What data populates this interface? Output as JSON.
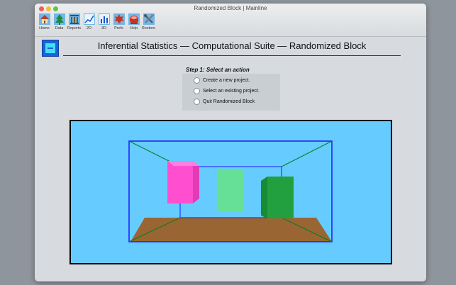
{
  "window": {
    "title": "Randomized Block | Mainline"
  },
  "toolbar": [
    {
      "label": "Home",
      "icon": "home-icon"
    },
    {
      "label": "Data",
      "icon": "tree-icon"
    },
    {
      "label": "Reports",
      "icon": "columns-icon"
    },
    {
      "label": "2D",
      "icon": "line-chart-icon"
    },
    {
      "label": "3D",
      "icon": "bar-chart-icon"
    },
    {
      "label": "Prefs",
      "icon": "maple-leaf-icon"
    },
    {
      "label": "Help",
      "icon": "help-icon"
    },
    {
      "label": "Restore",
      "icon": "tools-icon"
    }
  ],
  "header": {
    "title": "Inferential Statistics — Computational Suite — Randomized Block"
  },
  "step": {
    "title": "Step 1: Select an action",
    "options": [
      {
        "label": "Create a new project."
      },
      {
        "label": "Select an existing project."
      },
      {
        "label": "Quit Randomized Block"
      }
    ]
  },
  "colors": {
    "sky": "#66ccff",
    "floor": "#996633",
    "block_pink": "#ff4fd0",
    "block_light_green": "#66e096",
    "block_dark_green": "#22a040",
    "frame_blue": "#1a1aff",
    "edge_green": "#0a7a2a"
  }
}
